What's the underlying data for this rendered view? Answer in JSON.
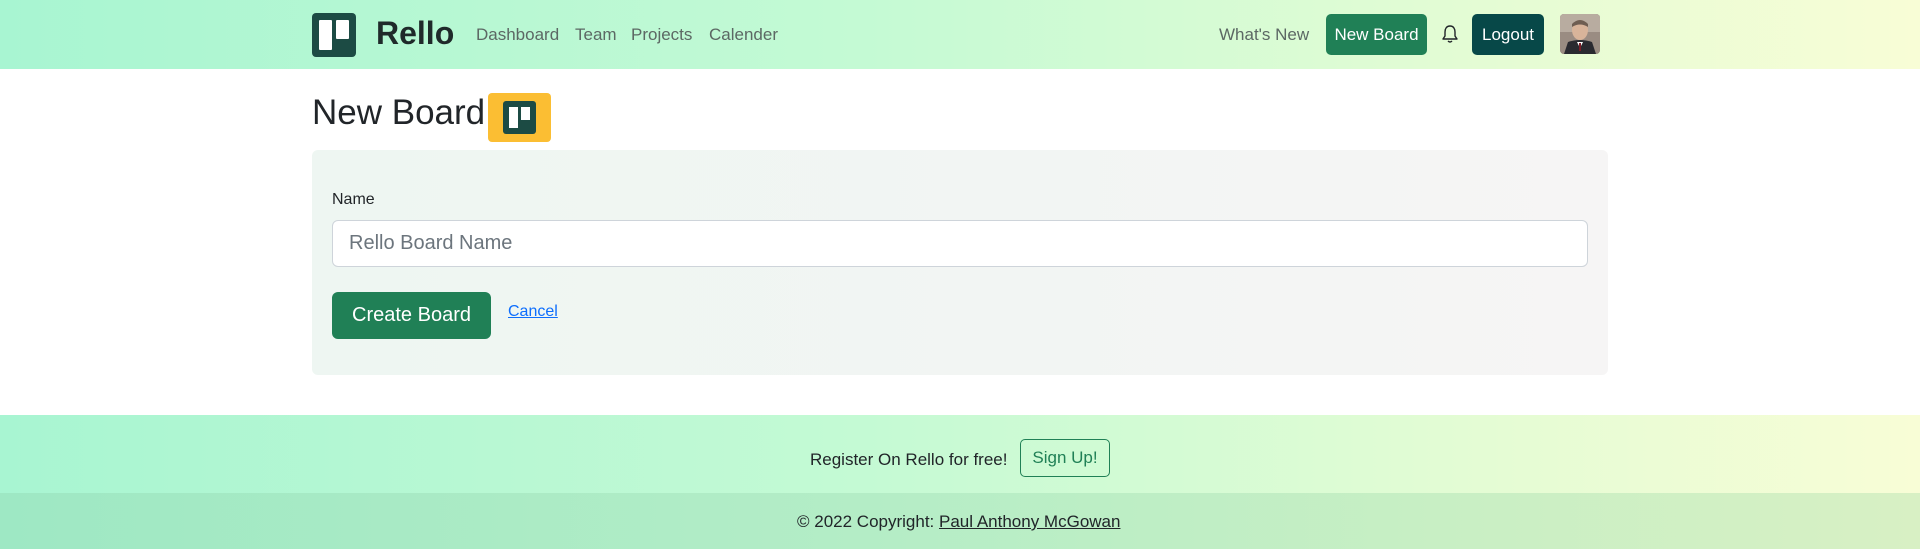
{
  "navbar": {
    "brand": "Rello",
    "links": [
      "Dashboard",
      "Team",
      "Projects",
      "Calender"
    ],
    "whats_new": "What's New",
    "new_board": "New Board",
    "logout": "Logout"
  },
  "main": {
    "title": "New Board",
    "form": {
      "name_label": "Name",
      "name_placeholder": "Rello Board Name",
      "name_value": "",
      "create_button": "Create Board",
      "cancel_link": "Cancel"
    }
  },
  "footer": {
    "register_text": "Register On Rello for free!",
    "signup_button": "Sign Up!",
    "copyright_prefix": "© 2022 Copyright:",
    "copyright_name": "Paul Anthony McGowan"
  },
  "colors": {
    "brand_dark": "#1c4b44",
    "primary_green": "#208056",
    "logout_teal": "#074848",
    "badge_yellow": "#fbbe33",
    "link_blue": "#0d6efd"
  },
  "icons": [
    "rello-logo-icon",
    "bell-icon",
    "user-avatar"
  ]
}
